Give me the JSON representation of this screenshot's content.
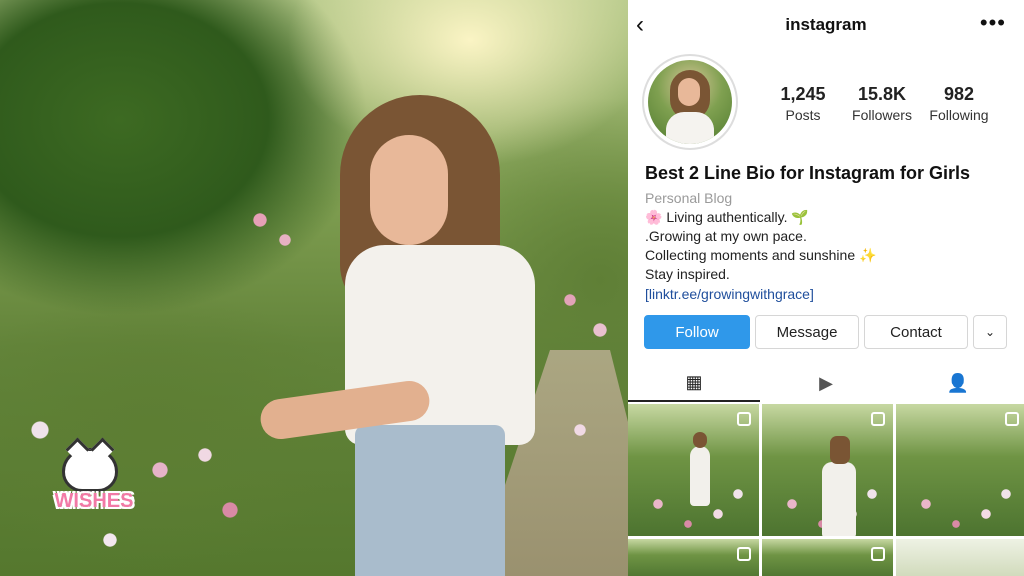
{
  "photo": {
    "watermark": "WISHES"
  },
  "profile": {
    "header_title": "instagram",
    "stats": [
      {
        "number": "1,245",
        "label": "Posts"
      },
      {
        "number": "15.8K",
        "label": "Followers"
      },
      {
        "number": "982",
        "label": "Following"
      }
    ],
    "bio": {
      "name": "Best 2 Line Bio for Instagram for Girls",
      "category": "Personal Blog",
      "lines": [
        "🌸 Living authentically. 🌱",
        ".Growing at my own pace.",
        "Collecting moments and sunshine ✨",
        "Stay inspired."
      ],
      "link": "[linktr.ee/growingwithgrace]"
    },
    "buttons": {
      "follow": "Follow",
      "message": "Message",
      "contact": "Contact",
      "dropdown": "⌄"
    },
    "icons": {
      "back": "‹",
      "more": "•••",
      "grid": "▦",
      "reels": "▶",
      "tagged": "👤"
    },
    "colors": {
      "follow_button": "#2f98ea",
      "link": "#1f4e9c",
      "category": "#9a9a9a"
    }
  }
}
